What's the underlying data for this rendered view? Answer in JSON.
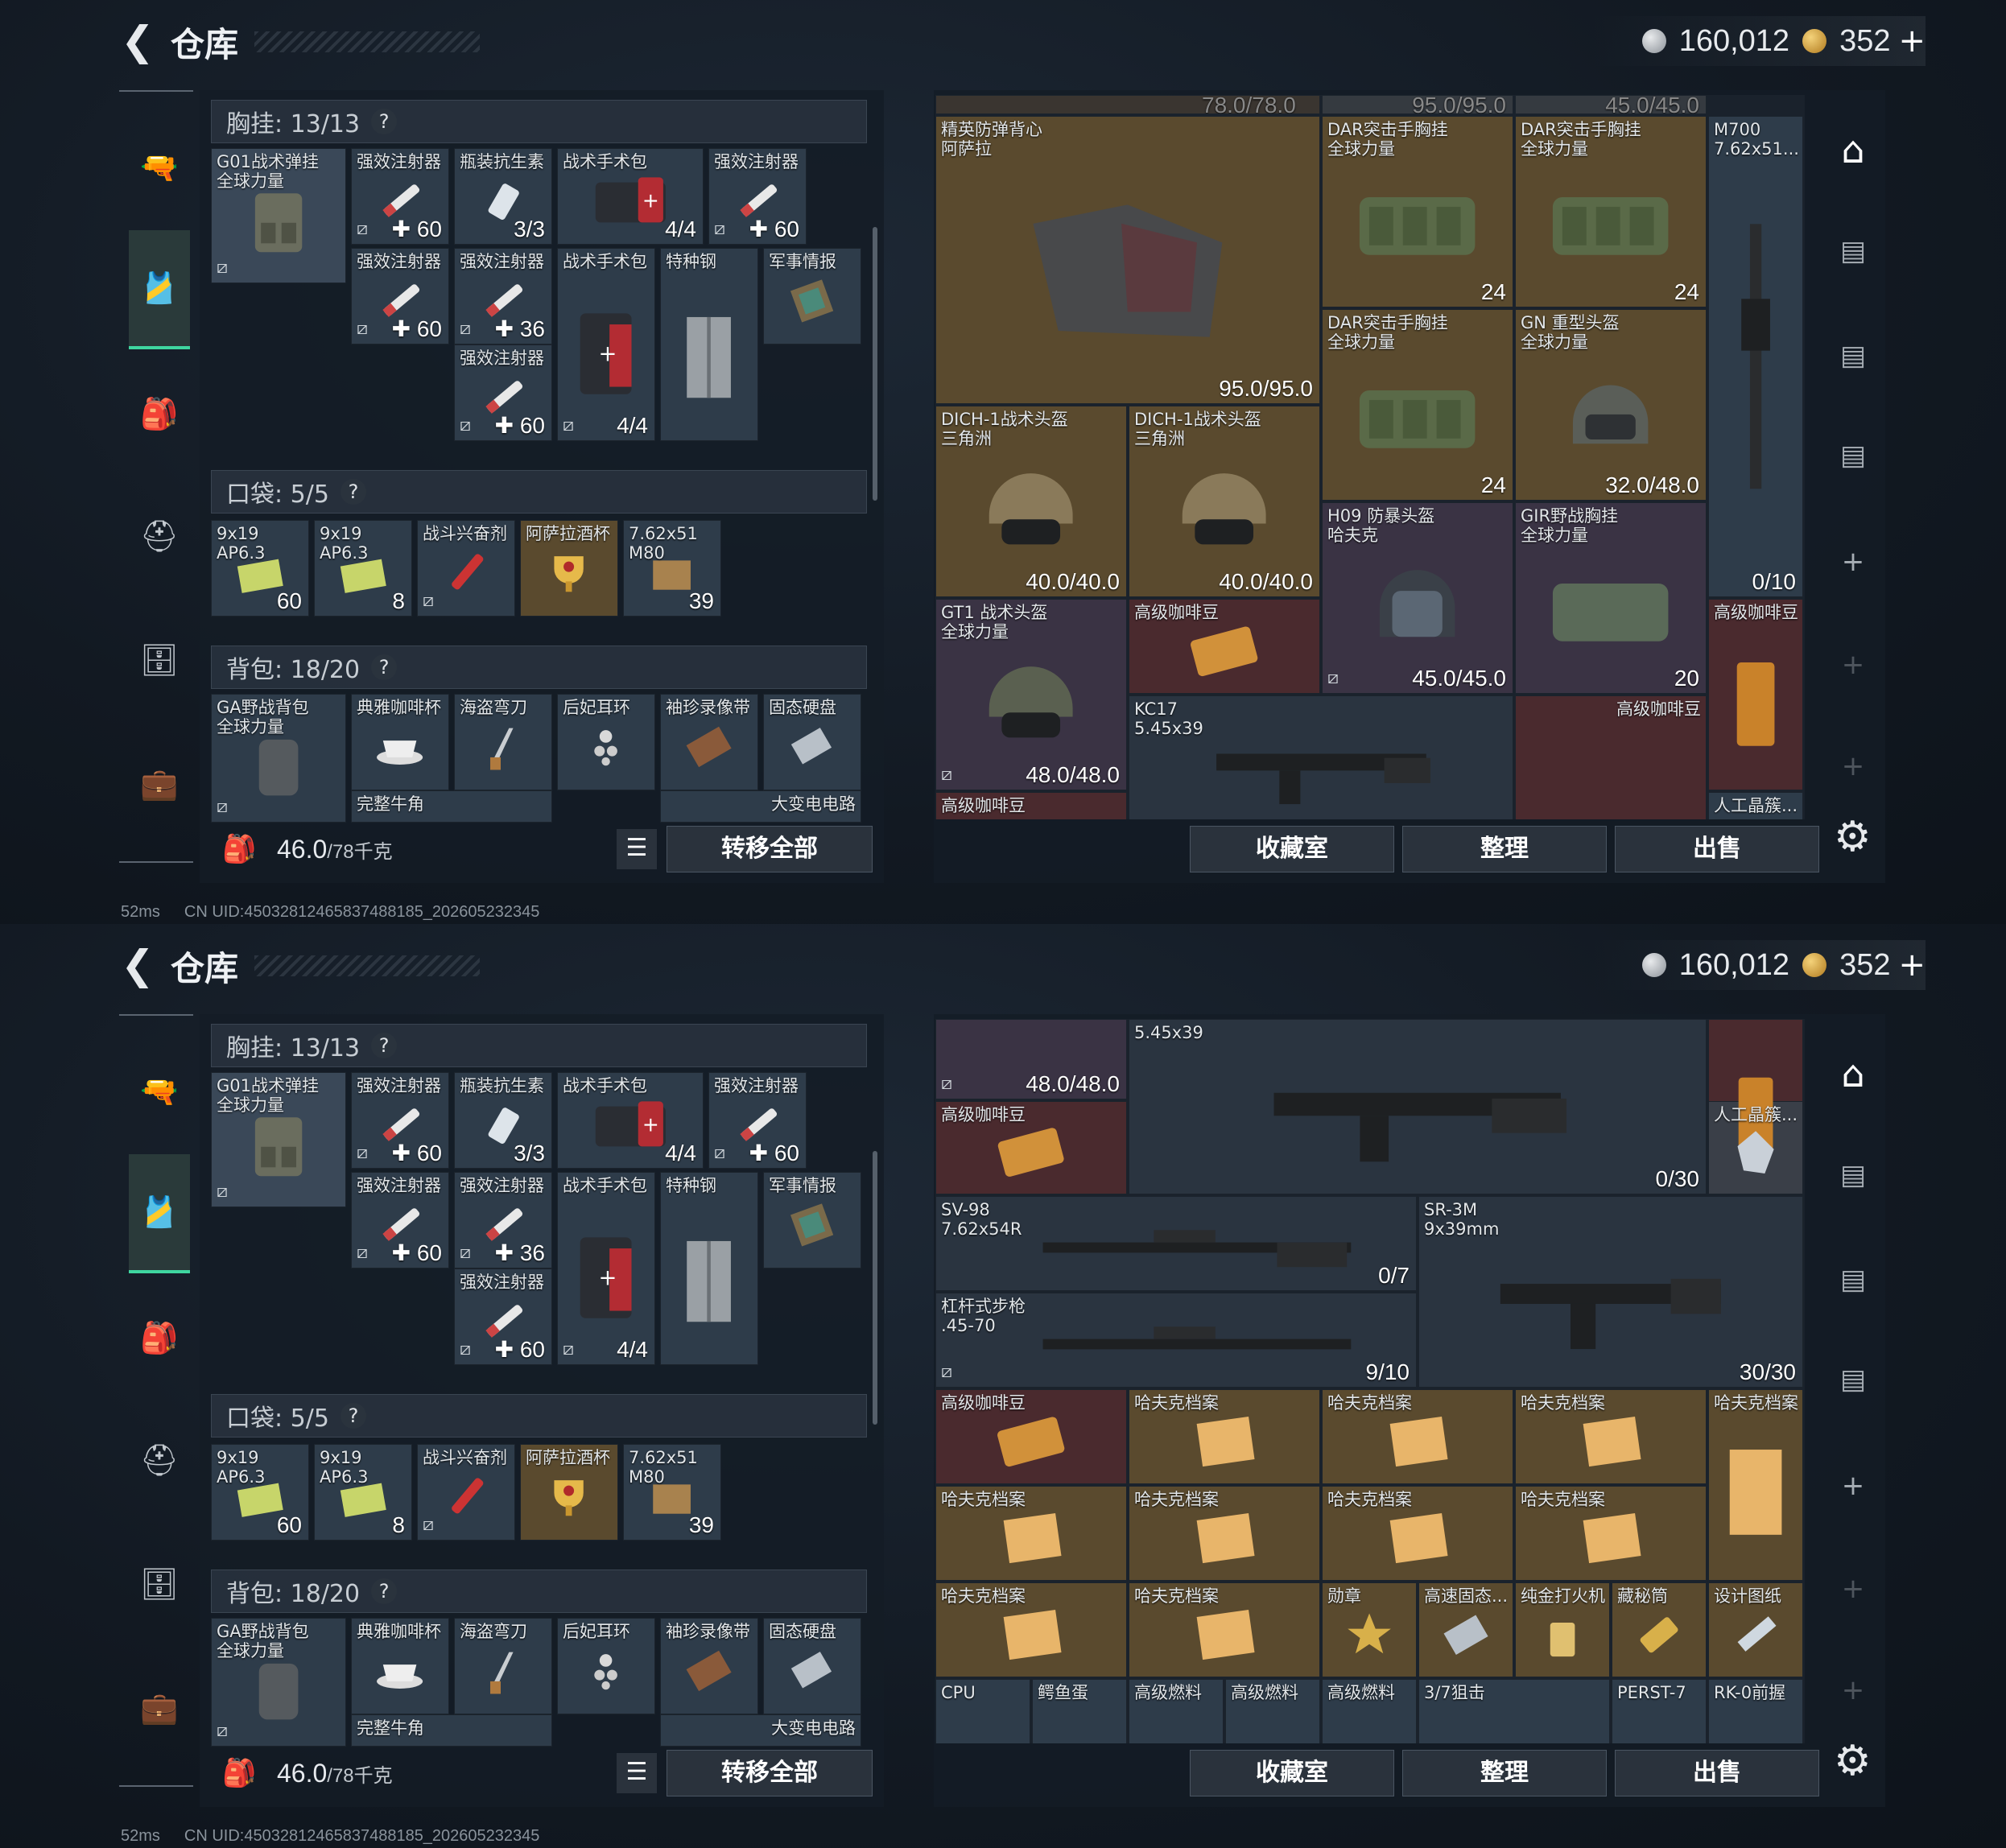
{
  "header": {
    "title": "仓库",
    "currency_silver": "160,012",
    "currency_gold": "352"
  },
  "left": {
    "chest_label": "胸挂: 13/13",
    "pocket_label": "口袋: 5/5",
    "backpack_label": "背包: 18/20",
    "weight_value": "46.0",
    "weight_unit": "/78千克",
    "transfer_all": "转移全部",
    "chest_items": [
      {
        "name": "G01战术弹挂\n全球力量",
        "qty": ""
      },
      {
        "name": "强效注射器",
        "qty": "✚ 60"
      },
      {
        "name": "瓶装抗生素",
        "qty": "3/3"
      },
      {
        "name": "战术手术包",
        "qty": "4/4"
      },
      {
        "name": "强效注射器",
        "qty": "✚ 60"
      },
      {
        "name": "强效注射器",
        "qty": "✚ 60"
      },
      {
        "name": "强效注射器",
        "qty": "✚ 36"
      },
      {
        "name": "战术手术包",
        "qty": "4/4"
      },
      {
        "name": "特种钢",
        "qty": ""
      },
      {
        "name": "军事情报",
        "qty": ""
      },
      {
        "name": "强效注射器",
        "qty": "✚ 60"
      }
    ],
    "pocket_items": [
      {
        "name": "9x19\nAP6.3",
        "qty": "60"
      },
      {
        "name": "9x19\nAP6.3",
        "qty": "8"
      },
      {
        "name": "战斗兴奋剂",
        "qty": ""
      },
      {
        "name": "阿萨拉酒杯",
        "qty": ""
      },
      {
        "name": "7.62x51\nM80",
        "qty": "39"
      }
    ],
    "backpack_items": [
      {
        "name": "GA野战背包\n全球力量"
      },
      {
        "name": "典雅咖啡杯"
      },
      {
        "name": "海盗弯刀"
      },
      {
        "name": "后妃耳环"
      },
      {
        "name": "袖珍录像带"
      },
      {
        "name": "固态硬盘"
      },
      {
        "name": "完整牛角"
      },
      {
        "name": "大变电电路"
      }
    ]
  },
  "right": {
    "buttons": [
      "收藏室",
      "整理",
      "出售"
    ],
    "p1_items": [
      {
        "name": "",
        "qty": "78.0/78.0"
      },
      {
        "name": "",
        "qty": "95.0/95.0"
      },
      {
        "name": "",
        "qty": "45.0/45.0"
      },
      {
        "name": "精英防弹背心\n阿萨拉",
        "qty": "95.0/95.0"
      },
      {
        "name": "DAR突击手胸挂\n全球力量",
        "qty": "24"
      },
      {
        "name": "DAR突击手胸挂\n全球力量",
        "qty": "24"
      },
      {
        "name": "M700\n7.62x51...",
        "qty": "0/10"
      },
      {
        "name": "DAR突击手胸挂\n全球力量",
        "qty": "24"
      },
      {
        "name": "GN 重型头盔\n全球力量",
        "qty": "32.0/48.0"
      },
      {
        "name": "DICH-1战术头盔\n三角洲",
        "qty": "40.0/40.0"
      },
      {
        "name": "DICH-1战术头盔\n三角洲",
        "qty": "40.0/40.0"
      },
      {
        "name": "H09 防暴头盔\n哈夫克",
        "qty": "45.0/45.0"
      },
      {
        "name": "GIR野战胸挂\n全球力量",
        "qty": "20"
      },
      {
        "name": "GT1 战术头盔\n全球力量",
        "qty": "48.0/48.0"
      },
      {
        "name": "高级咖啡豆",
        "qty": ""
      },
      {
        "name": "高级咖啡豆",
        "qty": ""
      },
      {
        "name": "KC17\n5.45x39",
        "qty": ""
      },
      {
        "name": "高级咖啡豆",
        "qty": ""
      },
      {
        "name": "高级咖啡豆",
        "qty": ""
      },
      {
        "name": "人工晶簇...",
        "qty": ""
      }
    ],
    "p2_items": [
      {
        "name": "",
        "qty": "48.0/48.0"
      },
      {
        "name": "5.45x39",
        "qty": "0/30"
      },
      {
        "name": "高级咖啡豆",
        "qty": ""
      },
      {
        "name": "人工晶簇...",
        "qty": ""
      },
      {
        "name": "SV-98\n7.62x54R",
        "qty": "0/7"
      },
      {
        "name": "SR-3M\n9x39mm",
        "qty": "30/30"
      },
      {
        "name": "杠杆式步枪\n.45-70",
        "qty": "9/10"
      },
      {
        "name": "高级咖啡豆",
        "qty": ""
      },
      {
        "name": "哈夫克档案",
        "qty": ""
      },
      {
        "name": "哈夫克档案",
        "qty": ""
      },
      {
        "name": "哈夫克档案",
        "qty": ""
      },
      {
        "name": "哈夫克档案",
        "qty": ""
      },
      {
        "name": "哈夫克档案",
        "qty": ""
      },
      {
        "name": "哈夫克档案",
        "qty": ""
      },
      {
        "name": "哈夫克档案",
        "qty": ""
      },
      {
        "name": "哈夫克档案",
        "qty": ""
      },
      {
        "name": "哈夫克档案",
        "qty": ""
      },
      {
        "name": "哈夫克档案",
        "qty": ""
      },
      {
        "name": "勋章",
        "qty": ""
      },
      {
        "name": "高速固态...",
        "qty": ""
      },
      {
        "name": "纯金打火机",
        "qty": ""
      },
      {
        "name": "藏秘筒",
        "qty": ""
      },
      {
        "name": "设计图纸",
        "qty": ""
      },
      {
        "name": "CPU",
        "qty": ""
      },
      {
        "name": "鳄鱼蛋",
        "qty": ""
      },
      {
        "name": "高级燃料",
        "qty": ""
      },
      {
        "name": "高级燃料",
        "qty": ""
      },
      {
        "name": "高级燃料",
        "qty": ""
      },
      {
        "name": "3/7狙击",
        "qty": ""
      },
      {
        "name": "PERST-7",
        "qty": ""
      },
      {
        "name": "RK-0前握",
        "qty": ""
      }
    ]
  },
  "status": {
    "ping": "52ms",
    "uid": "CN UID:45032812465837488185_202605232345"
  }
}
